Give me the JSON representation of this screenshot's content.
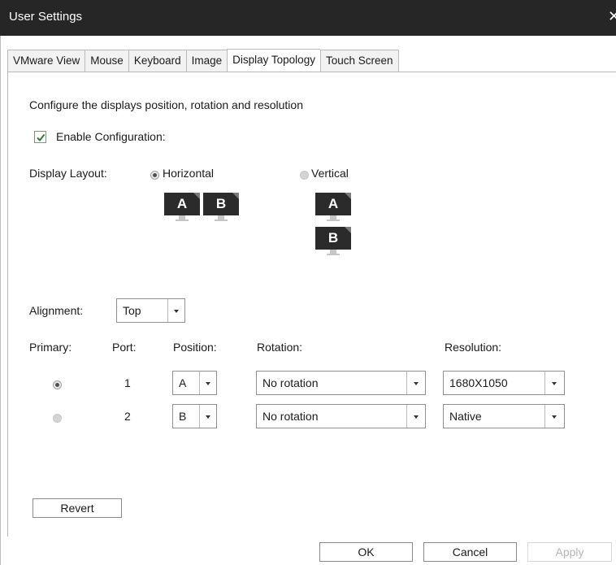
{
  "window": {
    "title": "User Settings",
    "close_glyph": "✕"
  },
  "tabs": [
    {
      "label": "VMware View",
      "active": false
    },
    {
      "label": "Mouse",
      "active": false
    },
    {
      "label": "Keyboard",
      "active": false
    },
    {
      "label": "Image",
      "active": false
    },
    {
      "label": "Display Topology",
      "active": true
    },
    {
      "label": "Touch Screen",
      "active": false
    }
  ],
  "panel": {
    "description": "Configure the displays position, rotation and resolution",
    "enable_config": {
      "label": "Enable Configuration:",
      "checked": true
    },
    "layout": {
      "label": "Display Layout:",
      "horizontal_label": "Horizontal",
      "vertical_label": "Vertical",
      "selected": "Horizontal",
      "monitor_a": "A",
      "monitor_b": "B"
    },
    "alignment": {
      "label": "Alignment:",
      "value": "Top"
    },
    "columns": {
      "primary": "Primary:",
      "port": "Port:",
      "position": "Position:",
      "rotation": "Rotation:",
      "resolution": "Resolution:"
    },
    "rows": [
      {
        "primary": true,
        "port": "1",
        "position": "A",
        "rotation": "No rotation",
        "resolution": "1680X1050"
      },
      {
        "primary": false,
        "port": "2",
        "position": "B",
        "rotation": "No rotation",
        "resolution": "Native"
      }
    ],
    "revert_label": "Revert"
  },
  "footer": {
    "ok_label": "OK",
    "cancel_label": "Cancel",
    "apply_label": "Apply"
  },
  "colors": {
    "titlebar": "#262626",
    "monitor": "#2b2b2b",
    "check": "#3a8a3a"
  },
  "icons": {
    "close": "close-icon",
    "check": "checkmark-icon",
    "monitor": "monitor-icon",
    "dropdown_arrow": "chevron-down-icon"
  }
}
